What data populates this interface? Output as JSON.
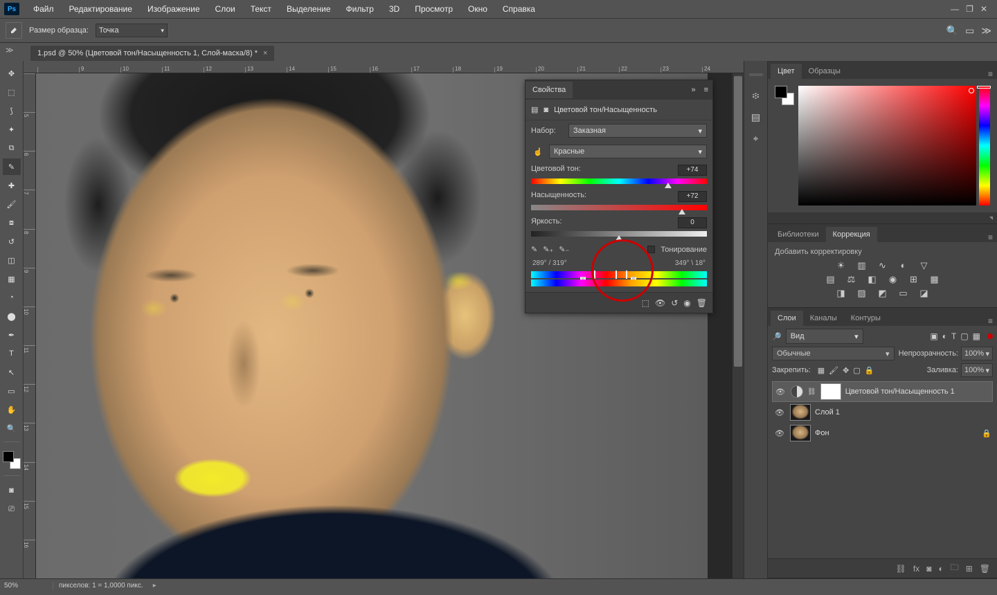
{
  "menu": {
    "items": [
      "Файл",
      "Редактирование",
      "Изображение",
      "Слои",
      "Текст",
      "Выделение",
      "Фильтр",
      "3D",
      "Просмотр",
      "Окно",
      "Справка"
    ]
  },
  "options": {
    "sample_label": "Размер образца:",
    "sample_value": "Точка"
  },
  "document_tab": "1.psd @ 50% (Цветовой тон/Насыщенность 1, Слой-маска/8) *",
  "ruler_h": [
    "",
    "9",
    "10",
    "11",
    "12",
    "13",
    "14",
    "15",
    "16",
    "17",
    "18",
    "19",
    "20",
    "21",
    "22",
    "23",
    "24"
  ],
  "ruler_v": [
    "",
    "5",
    "6",
    "7",
    "8",
    "9",
    "10",
    "11",
    "12",
    "13",
    "14",
    "15",
    "16"
  ],
  "properties": {
    "tab": "Свойства",
    "title": "Цветовой тон/Насыщенность",
    "preset_label": "Набор:",
    "preset_value": "Заказная",
    "channel_value": "Красные",
    "hue_label": "Цветовой тон:",
    "hue_value": "+74",
    "sat_label": "Насыщенность:",
    "sat_value": "+72",
    "lig_label": "Яркость:",
    "lig_value": "0",
    "colorize_label": "Тонирование",
    "range_left": "289° / 319°",
    "range_right": "349° \\ 18°"
  },
  "right": {
    "color_tab": "Цвет",
    "swatches_tab": "Образцы",
    "libraries_tab": "Библиотеки",
    "adjustments_tab": "Коррекция",
    "adjustments_subtitle": "Добавить корректировку",
    "layers_tab": "Слои",
    "channels_tab": "Каналы",
    "paths_tab": "Контуры",
    "kind_label": "Вид",
    "blend_mode": "Обычные",
    "opacity_label": "Непрозрачность:",
    "opacity_value": "100%",
    "lock_label": "Закрепить:",
    "fill_label": "Заливка:",
    "fill_value": "100%",
    "layers": [
      {
        "name": "Цветовой тон/Насыщенность 1",
        "kind": "adjustment",
        "selected": true
      },
      {
        "name": "Слой 1",
        "kind": "raster",
        "selected": false
      },
      {
        "name": "Фон",
        "kind": "raster",
        "locked": true,
        "selected": false
      }
    ]
  },
  "status": {
    "zoom": "50%",
    "info": "пикселов: 1 = 1,0000 пикс."
  }
}
